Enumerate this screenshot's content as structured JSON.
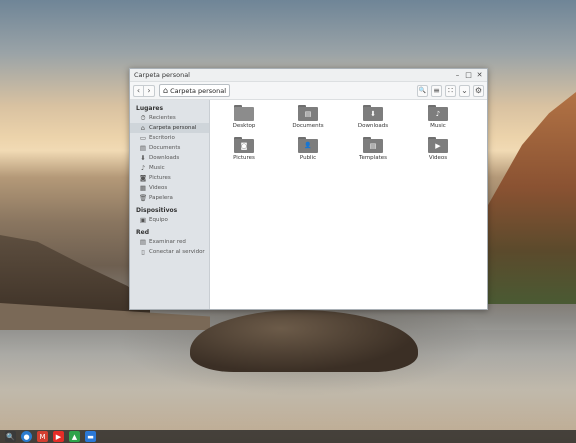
{
  "window": {
    "title": "Carpeta personal",
    "controls": {
      "minimize": "–",
      "maximize": "□",
      "close": "✕"
    }
  },
  "toolbar": {
    "back_icon": "‹",
    "forward_icon": "›",
    "path_label": "Carpeta personal",
    "search_icon": "🔍",
    "list_view_icon": "≡",
    "grid_view_icon": "∷",
    "dropdown_icon": "⌄",
    "settings_icon": "⚙"
  },
  "sidebar": {
    "places_header": "Lugares",
    "places": [
      {
        "label": "Recientes",
        "icon": "⏱"
      },
      {
        "label": "Carpeta personal",
        "icon": "⌂"
      },
      {
        "label": "Escritorio",
        "icon": "▭"
      },
      {
        "label": "Documents",
        "icon": "▤"
      },
      {
        "label": "Downloads",
        "icon": "⬇"
      },
      {
        "label": "Music",
        "icon": "♪"
      },
      {
        "label": "Pictures",
        "icon": "◙"
      },
      {
        "label": "Videos",
        "icon": "▦"
      },
      {
        "label": "Papelera",
        "icon": "🗑"
      }
    ],
    "devices_header": "Dispositivos",
    "devices": [
      {
        "label": "Equipo",
        "icon": "▣"
      }
    ],
    "network_header": "Red",
    "network": [
      {
        "label": "Examinar red",
        "icon": "▤"
      },
      {
        "label": "Conectar al servidor",
        "icon": "▯"
      }
    ]
  },
  "files": [
    {
      "label": "Desktop",
      "emblem": ""
    },
    {
      "label": "Documents",
      "emblem": "▤"
    },
    {
      "label": "Downloads",
      "emblem": "⬇"
    },
    {
      "label": "Music",
      "emblem": "♪"
    },
    {
      "label": "Pictures",
      "emblem": "◙"
    },
    {
      "label": "Public",
      "emblem": "👤"
    },
    {
      "label": "Templates",
      "emblem": "▤"
    },
    {
      "label": "Videos",
      "emblem": "▶"
    }
  ],
  "taskbar": {
    "icons": [
      {
        "name": "search",
        "glyph": "🔍",
        "color": "#3a3a3a"
      },
      {
        "name": "chrome",
        "glyph": "●",
        "color": "#2c7ccf"
      },
      {
        "name": "gmail",
        "glyph": "M",
        "color": "#d23f31"
      },
      {
        "name": "youtube",
        "glyph": "▶",
        "color": "#e52d27"
      },
      {
        "name": "drive",
        "glyph": "▲",
        "color": "#2fa34a"
      },
      {
        "name": "files",
        "glyph": "▬",
        "color": "#2b78d6"
      }
    ]
  }
}
